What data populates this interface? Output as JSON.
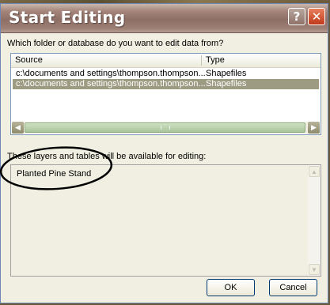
{
  "window": {
    "title": "Start Editing",
    "help_glyph": "?",
    "close_glyph": "✕"
  },
  "prompt": {
    "folder_question": "Which folder or database do you want to edit data from?",
    "layers_label": "These layers and tables will be available for editing:"
  },
  "source_list": {
    "columns": [
      "Source",
      "Type"
    ],
    "rows": [
      {
        "source": "c:\\documents and settings\\thompson.thompson...",
        "type": "Shapefiles",
        "selected": false
      },
      {
        "source": "c:\\documents and settings\\thompson.thompson...",
        "type": "Shapefiles",
        "selected": true
      }
    ]
  },
  "layers": {
    "items": [
      "Planted Pine Stand"
    ]
  },
  "buttons": {
    "ok": "OK",
    "cancel": "Cancel"
  },
  "icons": {
    "help": "question-mark-icon",
    "close": "close-icon",
    "scroll_left": "arrow-left-icon",
    "scroll_right": "arrow-right-icon",
    "scroll_up": "arrow-up-icon",
    "scroll_down": "arrow-down-icon"
  },
  "colors": {
    "selection": "#9e9b83",
    "annotation_ellipse": "#000000"
  }
}
